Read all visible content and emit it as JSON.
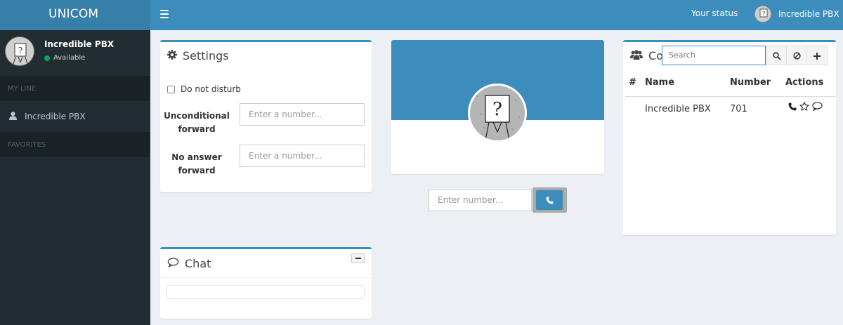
{
  "app": {
    "logo": "UNICOM"
  },
  "sidebar": {
    "user_name": "Incredible PBX",
    "user_status": "Available",
    "section_my_line": "MY LINE",
    "line_item": "Incredible PBX",
    "section_favorites": "FAVORITES"
  },
  "header": {
    "your_status": "Your status",
    "user_name": "Incredible PBX"
  },
  "settings": {
    "title": "Settings",
    "dnd_label": "Do not disturb",
    "uncond_label_1": "Unconditional",
    "uncond_label_2": "forward",
    "uncond_placeholder": "Enter a number...",
    "noanswer_label_1": "No answer",
    "noanswer_label_2": "forward",
    "noanswer_placeholder": "Enter a number..."
  },
  "dialer": {
    "placeholder": "Enter number..."
  },
  "contacts": {
    "title": "Co",
    "search_placeholder": "Search",
    "columns": {
      "hash": "#",
      "name": "Name",
      "number": "Number",
      "actions": "Actions"
    },
    "rows": [
      {
        "name": "Incredible PBX",
        "number": "701"
      }
    ]
  },
  "chat": {
    "title": "Chat"
  },
  "colors": {
    "primary": "#3c8dbc",
    "sidebar": "#222d32",
    "available": "#00a65a"
  },
  "icons": {
    "settings": "gear-icon",
    "contacts": "users-icon",
    "chat": "speech-bubble-icon",
    "line": "user-icon",
    "call": "phone-icon",
    "favorite": "star-icon",
    "message": "speech-bubble-icon",
    "search": "search-icon",
    "clear": "ban-icon",
    "add": "plus-icon",
    "menu": "hamburger-icon"
  }
}
